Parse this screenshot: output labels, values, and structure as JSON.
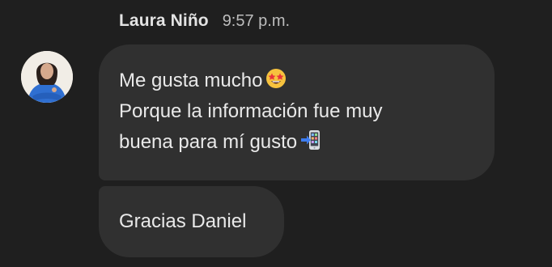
{
  "message": {
    "sender": "Laura Niño",
    "time": "9:57 p.m.",
    "bubbles": [
      {
        "lines": [
          {
            "text": "Me gusta mucho",
            "emoji": "star-struck-emoji"
          },
          {
            "text": "Porque la información fue muy",
            "emoji": null
          },
          {
            "text": "buena para mí gusto",
            "emoji": "mobile-phone-arrow-emoji"
          }
        ]
      },
      {
        "lines": [
          {
            "text": "Gracias Daniel",
            "emoji": null
          }
        ]
      }
    ]
  },
  "colors": {
    "background": "#1f1f1f",
    "bubble": "#303030",
    "text": "#e9e9e9",
    "timestamp": "#bdbdbd"
  }
}
